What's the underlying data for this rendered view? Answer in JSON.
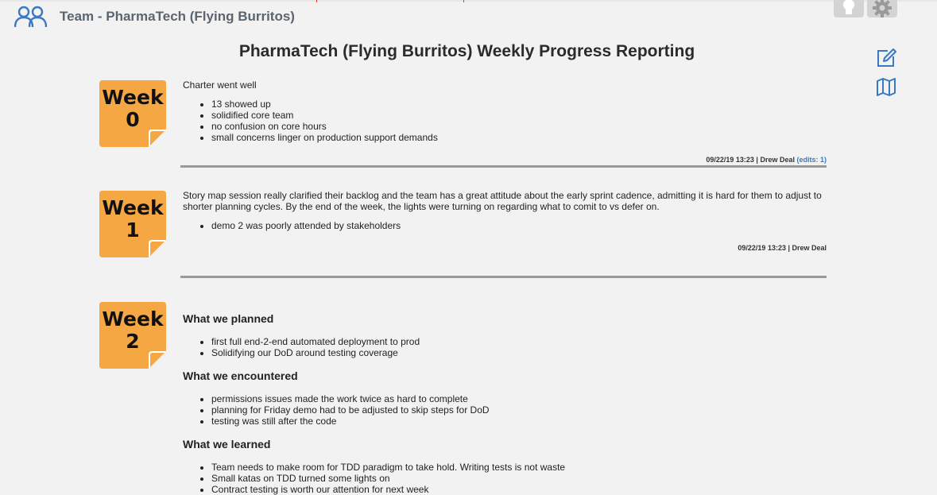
{
  "header": {
    "title": "Team - PharmaTech (Flying Burritos)"
  },
  "icons": {
    "team": "team-icon",
    "bulb": "lightbulb-icon",
    "gear": "gear-icon",
    "edit": "edit-icon",
    "map": "map-icon"
  },
  "colors": {
    "accent": "#3b78c2",
    "badge": "#f4a742",
    "badge_fold": "#e8922a",
    "divider": "#9a9a9a"
  },
  "page_title": "PharmaTech (Flying Burritos) Weekly Progress Reporting",
  "weeks": [
    {
      "badge_line1": "Week",
      "badge_line2": "0",
      "intro": "Charter went well",
      "bullets": [
        "13 showed up",
        "solidified core team",
        "no confusion on core hours",
        "small concerns linger on production support demands"
      ],
      "meta": "09/22/19 13:23 | Drew Deal",
      "edits": "(edits: 1)"
    },
    {
      "badge_line1": "Week",
      "badge_line2": "1",
      "intro": "Story map session really clarified their backlog and the team has a great attitude about the early sprint cadence, admitting it is hard for them to adjust to shorter planning cycles. By the end of the week, the lights were turning on regarding what to comit to vs defer on.",
      "bullets": [
        "demo 2 was poorly attended by stakeholders"
      ],
      "meta": "09/22/19 13:23 | Drew Deal"
    },
    {
      "badge_line1": "Week",
      "badge_line2": "2",
      "sections": [
        {
          "heading": "What we planned",
          "bullets": [
            "first full end-2-end automated deployment to prod",
            "Solidifying our DoD around testing coverage"
          ]
        },
        {
          "heading": "What we encountered",
          "bullets": [
            "permissions issues made the work twice as hard to complete",
            "planning for Friday demo had to be adjusted to skip steps for DoD",
            "testing was still after the code"
          ]
        },
        {
          "heading": "What we learned",
          "bullets": [
            "Team needs to make room for TDD paradigm to take hold. Writing tests is not waste",
            "Small katas on TDD turned some lights on",
            "Contract testing is worth our attention for next week"
          ]
        }
      ]
    }
  ]
}
